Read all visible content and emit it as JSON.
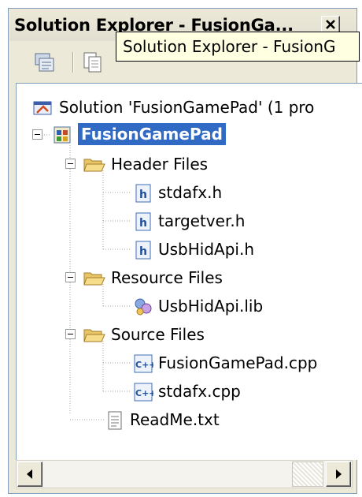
{
  "window": {
    "title": "Solution Explorer - FusionGa..."
  },
  "toolbar": {
    "buttons": [
      {
        "icon": "properties-icon"
      },
      {
        "icon": "show-all-files-icon"
      }
    ],
    "tooltip": "Solution Explorer - FusionG"
  },
  "tree": {
    "solution": "Solution 'FusionGamePad' (1 pro",
    "project": "FusionGamePad",
    "header_folder": "Header Files",
    "header_items": [
      "stdafx.h",
      "targetver.h",
      "UsbHidApi.h"
    ],
    "resource_folder": "Resource Files",
    "resource_items": [
      "UsbHidApi.lib"
    ],
    "source_folder": "Source Files",
    "source_items": [
      "FusionGamePad.cpp",
      "stdafx.cpp"
    ],
    "readme": "ReadMe.txt"
  },
  "colors": {
    "selection": "#316ac5",
    "tooltip_bg": "#ffffe1",
    "chrome": "#ece9d8"
  }
}
